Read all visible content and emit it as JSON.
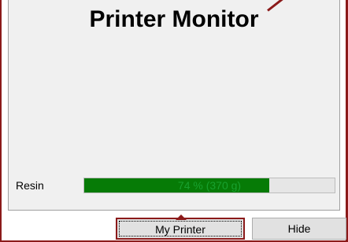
{
  "window": {
    "title": "Printer Monitor"
  },
  "resin": {
    "label": "Resin",
    "progress_percent": 74,
    "progress_text": "74 % (370 g)"
  },
  "buttons": {
    "my_printer_label": "My Printer",
    "hide_label": "Hide"
  },
  "colors": {
    "frame_border": "#8b1a1a",
    "panel_background": "#f0f0f0",
    "progress_fill": "#067b06",
    "progress_text": "#18a12f"
  }
}
